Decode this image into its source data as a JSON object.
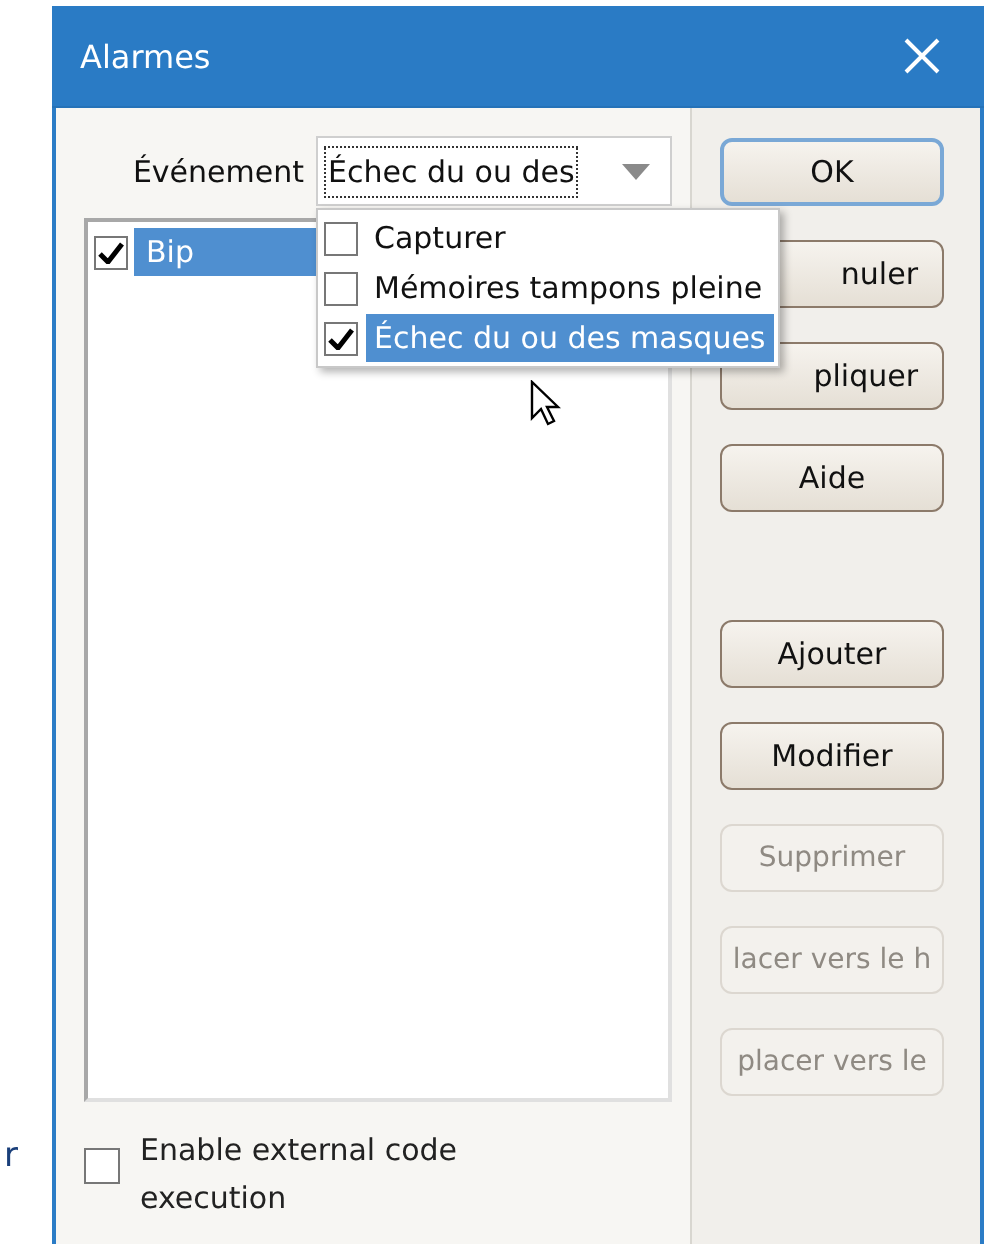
{
  "side_text": "r",
  "window": {
    "title": "Alarmes"
  },
  "event_field": {
    "label": "Événement",
    "value": "Échec du ou des"
  },
  "alarm_list": [
    {
      "label": "Bip",
      "checked": true,
      "selected": true
    }
  ],
  "dropdown": [
    {
      "label": "Capturer",
      "checked": false,
      "selected": false
    },
    {
      "label": "Mémoires tampons pleine",
      "checked": false,
      "selected": false
    },
    {
      "label": "Échec du ou des masques",
      "checked": true,
      "selected": true
    }
  ],
  "external_code": {
    "label": "Enable external code execution",
    "checked": false
  },
  "button_groups": [
    [
      {
        "label": "OK",
        "default": true,
        "disabled": false,
        "covered": false
      },
      {
        "label": "nuler",
        "default": false,
        "disabled": false,
        "covered": true
      },
      {
        "label": "pliquer",
        "default": false,
        "disabled": false,
        "covered": true
      },
      {
        "label": "Aide",
        "default": false,
        "disabled": false,
        "covered": false
      }
    ],
    [
      {
        "label": "Ajouter",
        "default": false,
        "disabled": false,
        "covered": false
      },
      {
        "label": "Modifier",
        "default": false,
        "disabled": false,
        "covered": false
      },
      {
        "label": "Supprimer",
        "default": false,
        "disabled": true,
        "covered": false
      },
      {
        "label": "lacer vers le h",
        "default": false,
        "disabled": true,
        "covered": false
      },
      {
        "label": "placer vers le",
        "default": false,
        "disabled": true,
        "covered": false
      }
    ]
  ]
}
